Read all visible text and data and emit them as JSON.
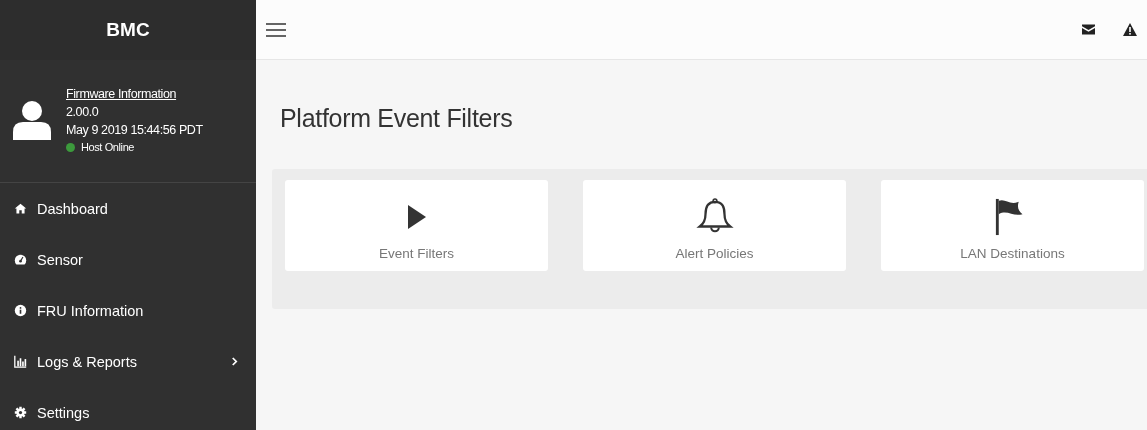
{
  "sidebar": {
    "brand": "BMC",
    "profile": {
      "link": "Firmware Information",
      "version": "2.00.0",
      "build_date": "May 9 2019 15:44:56 PDT",
      "host_status": "Host Online",
      "online": true
    },
    "items": [
      {
        "kind": "home",
        "label": "Dashboard",
        "expandable": false
      },
      {
        "kind": "gauge",
        "label": "Sensor",
        "expandable": false
      },
      {
        "kind": "info",
        "label": "FRU Information",
        "expandable": false
      },
      {
        "kind": "chart",
        "label": "Logs & Reports",
        "expandable": true
      },
      {
        "kind": "gear",
        "label": "Settings",
        "expandable": false
      }
    ]
  },
  "page": {
    "title": "Platform Event Filters",
    "tiles": [
      {
        "kind": "play",
        "label": "Event Filters"
      },
      {
        "kind": "bell",
        "label": "Alert Policies"
      },
      {
        "kind": "flag",
        "label": "LAN Destinations"
      }
    ]
  }
}
